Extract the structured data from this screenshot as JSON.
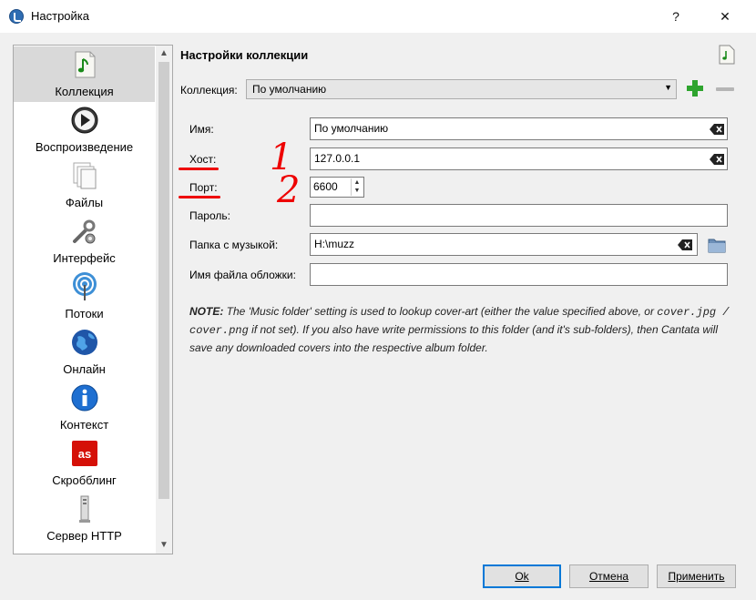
{
  "window": {
    "title": "Настройка",
    "help": "?",
    "close": "✕"
  },
  "sidebar": {
    "items": [
      {
        "label": "Коллекция",
        "icon": "collection-icon",
        "active": true
      },
      {
        "label": "Воспроизведение",
        "icon": "playback-icon"
      },
      {
        "label": "Файлы",
        "icon": "files-icon"
      },
      {
        "label": "Интерфейс",
        "icon": "interface-icon"
      },
      {
        "label": "Потоки",
        "icon": "streams-icon"
      },
      {
        "label": "Онлайн",
        "icon": "globe-icon"
      },
      {
        "label": "Контекст",
        "icon": "info-icon"
      },
      {
        "label": "Скробблинг",
        "icon": "lastfm-icon"
      },
      {
        "label": "Сервер HTTP",
        "icon": "http-server-icon"
      }
    ]
  },
  "panel": {
    "heading": "Настройки коллекции",
    "collection_label": "Коллекция:",
    "collection_value": "По умолчанию",
    "fields": {
      "name_label": "Имя:",
      "name_value": "По умолчанию",
      "host_label": "Хост:",
      "host_value": "127.0.0.1",
      "port_label": "Порт:",
      "port_value": "6600",
      "password_label": "Пароль:",
      "password_value": "",
      "music_label": "Папка с музыкой:",
      "music_value": "H:\\muzz",
      "cover_label": "Имя файла обложки:",
      "cover_value": ""
    },
    "note": {
      "bold": "NOTE:",
      "t1": " The 'Music folder' setting is used to lookup cover-art (either the value specified above, or",
      "mono": "cover.jpg / cover.png",
      "t2": " if not set). If you also have write permissions to this folder (and it's sub-folders), then Cantata will save any downloaded covers into the respective album folder."
    }
  },
  "annotations": {
    "one": "1",
    "two": "2",
    "color": "#e00000"
  },
  "buttons": {
    "ok": "Ok",
    "cancel": "Отмена",
    "apply": "Применить"
  },
  "colors": {
    "accent": "#0078d7",
    "green": "#2ea42e"
  }
}
